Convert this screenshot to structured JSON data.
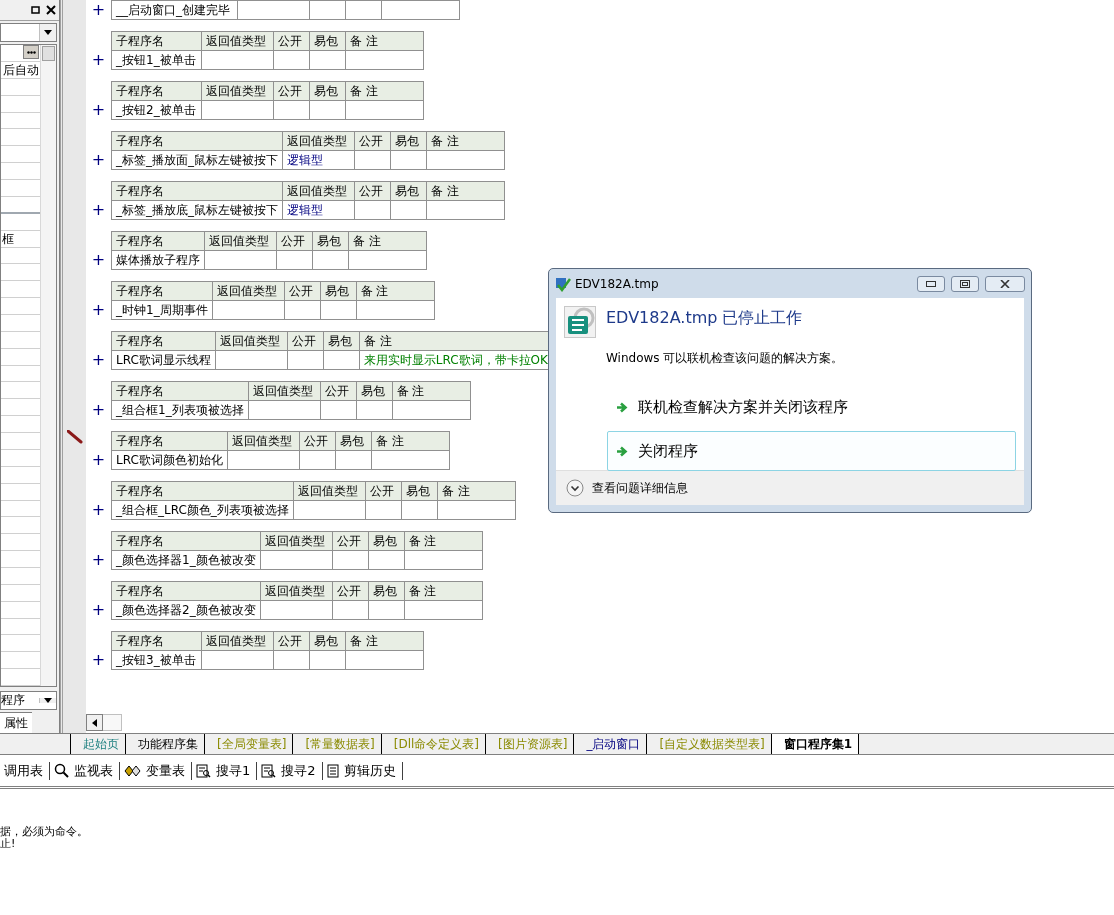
{
  "left_panel": {
    "value_1": "后自动",
    "value_2": "框",
    "bottom_dropdown": "程序",
    "tab": "属性"
  },
  "partial_row": {
    "expander": "+",
    "name": "__启动窗口_创建完毕"
  },
  "tables": [
    {
      "expander": "+",
      "headers": [
        "子程序名",
        "返回值类型",
        "公开",
        "易包",
        "备 注"
      ],
      "name": "_按钮1_被单击"
    },
    {
      "expander": "+",
      "headers": [
        "子程序名",
        "返回值类型",
        "公开",
        "易包",
        "备 注"
      ],
      "name": "_按钮2_被单击"
    },
    {
      "expander": "+",
      "headers": [
        "子程序名",
        "返回值类型",
        "公开",
        "易包",
        "备 注"
      ],
      "name": "_标签_播放面_鼠标左键被按下",
      "return_type": "逻辑型"
    },
    {
      "expander": "+",
      "headers": [
        "子程序名",
        "返回值类型",
        "公开",
        "易包",
        "备 注"
      ],
      "name": "_标签_播放底_鼠标左键被按下",
      "return_type": "逻辑型"
    },
    {
      "expander": "+",
      "headers": [
        "子程序名",
        "返回值类型",
        "公开",
        "易包",
        "备 注"
      ],
      "name": "媒体播放子程序"
    },
    {
      "expander": "+",
      "headers": [
        "子程序名",
        "返回值类型",
        "公开",
        "易包",
        "备 注"
      ],
      "name": "_时钟1_周期事件"
    },
    {
      "expander": "+",
      "headers": [
        "子程序名",
        "返回值类型",
        "公开",
        "易包",
        "备 注"
      ],
      "name": "LRC歌词显示线程",
      "note": "来用实时显示LRC歌词，带卡拉OK"
    },
    {
      "expander": "+",
      "headers": [
        "子程序名",
        "返回值类型",
        "公开",
        "易包",
        "备 注"
      ],
      "name": "_组合框1_列表项被选择"
    },
    {
      "expander": "+",
      "headers": [
        "子程序名",
        "返回值类型",
        "公开",
        "易包",
        "备 注"
      ],
      "name": "LRC歌词颜色初始化",
      "marked": true
    },
    {
      "expander": "+",
      "headers": [
        "子程序名",
        "返回值类型",
        "公开",
        "易包",
        "备 注"
      ],
      "name": "_组合框_LRC颜色_列表项被选择"
    },
    {
      "expander": "+",
      "headers": [
        "子程序名",
        "返回值类型",
        "公开",
        "易包",
        "备 注"
      ],
      "name": "_颜色选择器1_颜色被改变"
    },
    {
      "expander": "+",
      "headers": [
        "子程序名",
        "返回值类型",
        "公开",
        "易包",
        "备 注"
      ],
      "name": "_颜色选择器2_颜色被改变"
    },
    {
      "expander": "+",
      "headers": [
        "子程序名",
        "返回值类型",
        "公开",
        "易包",
        "备 注"
      ],
      "name": "_按钮3_被单击"
    }
  ],
  "tabs": [
    {
      "label": "起始页",
      "kind": "home",
      "selected": false
    },
    {
      "label": "功能程序集",
      "kind": "module",
      "selected": false
    },
    {
      "label": "[全局变量表]",
      "kind": "resource",
      "selected": false
    },
    {
      "label": "[常量数据表]",
      "kind": "resource",
      "selected": false
    },
    {
      "label": "[Dll命令定义表]",
      "kind": "resource",
      "selected": false
    },
    {
      "label": "[图片资源表]",
      "kind": "resource",
      "selected": false
    },
    {
      "label": "_启动窗口",
      "kind": "window",
      "selected": false
    },
    {
      "label": "[自定义数据类型表]",
      "kind": "resource",
      "selected": false
    },
    {
      "label": "窗口程序集1",
      "kind": "module",
      "selected": true
    }
  ],
  "toolbar": [
    {
      "label": "调用表",
      "kind": "none"
    },
    {
      "label": "监视表",
      "kind": "magnifier"
    },
    {
      "label": "变量表",
      "kind": "variables"
    },
    {
      "label": "搜寻1",
      "kind": "search"
    },
    {
      "label": "搜寻2",
      "kind": "search"
    },
    {
      "label": "剪辑历史",
      "kind": "document"
    }
  ],
  "output_lines": [
    "据，必须为命令。",
    "止!"
  ],
  "dialog": {
    "title": "EDV182A.tmp",
    "heading": "EDV182A.tmp 已停止工作",
    "message": "Windows 可以联机检查该问题的解决方案。",
    "options": [
      {
        "label": "联机检查解决方案并关闭该程序",
        "hovered": false
      },
      {
        "label": "关闭程序",
        "hovered": true
      }
    ],
    "details": "查看问题详细信息"
  }
}
